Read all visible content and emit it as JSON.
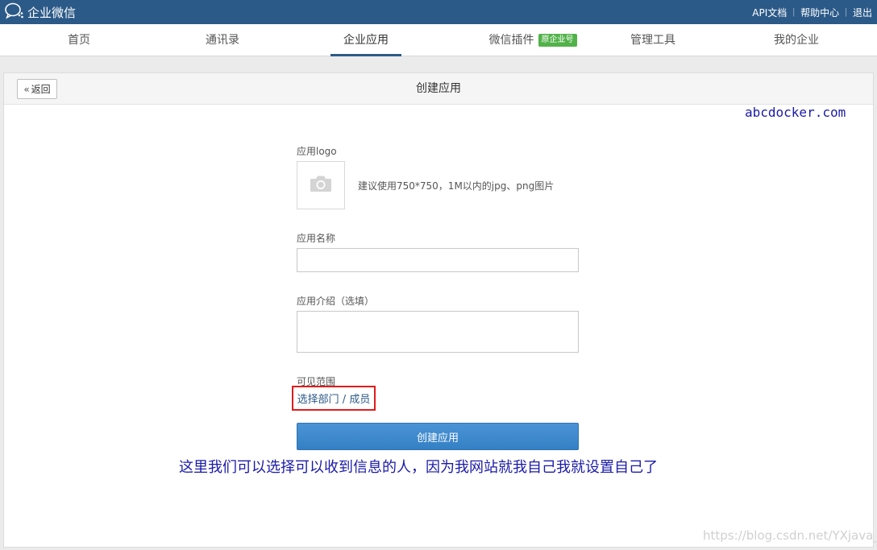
{
  "topbar": {
    "brand": "企业微信",
    "links": [
      "API文档",
      "帮助中心",
      "退出"
    ]
  },
  "nav": {
    "items": [
      {
        "label": "首页"
      },
      {
        "label": "通讯录"
      },
      {
        "label": "企业应用",
        "active": true
      },
      {
        "label": "微信插件",
        "badge": "原企业号"
      },
      {
        "label": "管理工具"
      },
      {
        "label": "我的企业"
      }
    ]
  },
  "panel": {
    "back_label": "返回",
    "title": "创建应用"
  },
  "watermark_top": "abcdocker.com",
  "form": {
    "logo_label": "应用logo",
    "logo_hint": "建议使用750*750，1M以内的jpg、png图片",
    "name_label": "应用名称",
    "name_value": "",
    "intro_label": "应用介绍（选填）",
    "intro_value": "",
    "visibility_label": "可见范围",
    "visibility_link": "选择部门 / 成员",
    "submit_label": "创建应用"
  },
  "annotation": "这里我们可以选择可以收到信息的人，因为我网站就我自己我就设置自己了",
  "watermark_bottom": "https://blog.csdn.net/YXjava_",
  "colors": {
    "topbar": "#2c5a88",
    "badge": "#52b24a",
    "primary_button": "#3d87cc",
    "highlight_box": "#e31b1b",
    "annotation_text": "#1a1aa8"
  }
}
